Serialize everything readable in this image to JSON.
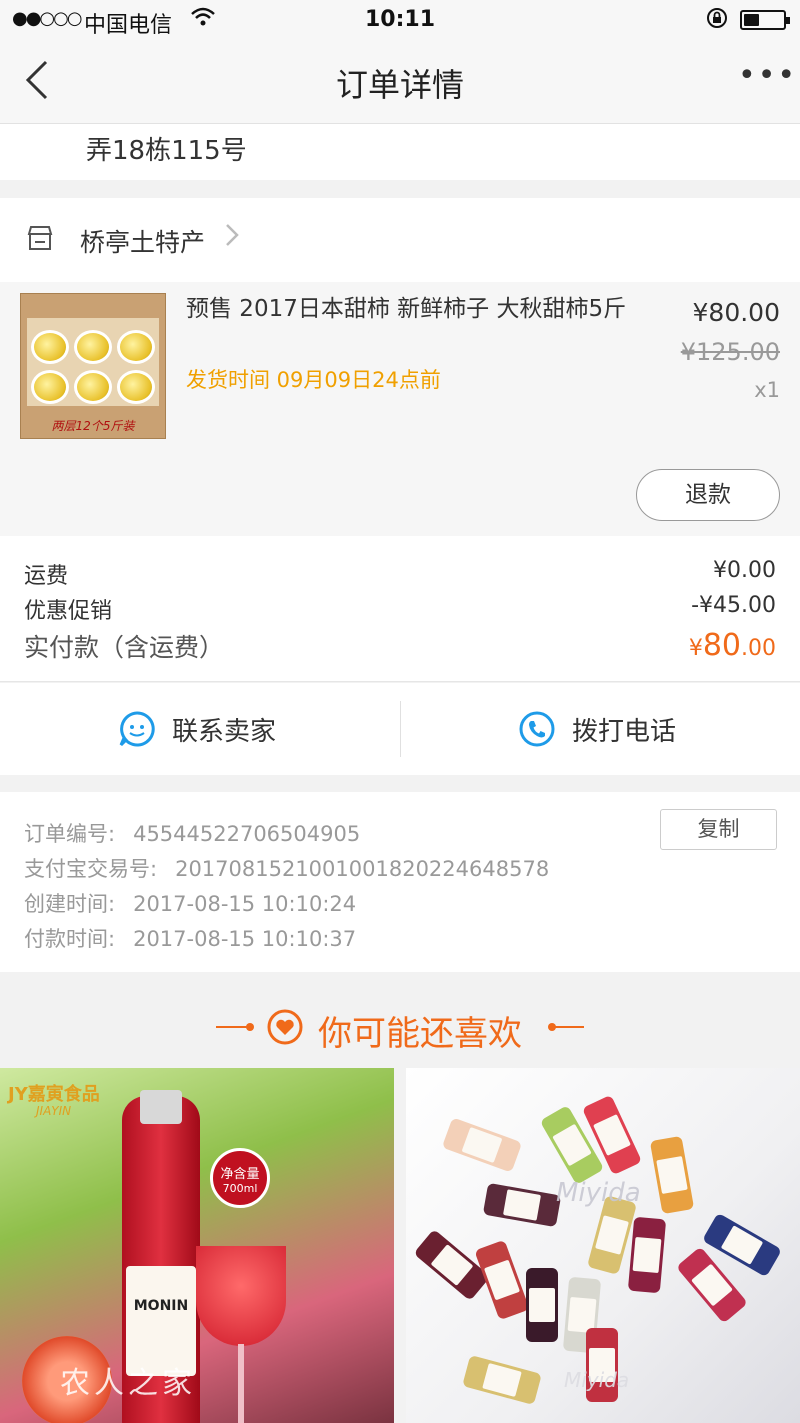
{
  "status_bar": {
    "signal": "●●○○○",
    "carrier": "中国电信",
    "time": "10:11",
    "battery_level": 0.4
  },
  "nav": {
    "title": "订单详情",
    "more": "•••"
  },
  "address": {
    "line_tail": "弄18栋115号"
  },
  "shop": {
    "name": "桥亭土特产"
  },
  "product": {
    "title": "预售 2017日本甜柿 新鲜柿子 大秋甜柿5斤",
    "ship_time": "发货时间 09月09日24点前",
    "price": "¥80.00",
    "original_price": "¥125.00",
    "quantity": "x1",
    "thumb_tag": "两层12个5斤装",
    "refund_label": "退款"
  },
  "fees": {
    "shipping_label": "运费",
    "shipping_value": "¥0.00",
    "discount_label": "优惠促销",
    "discount_value": "-¥45.00",
    "total_label": "实付款（含运费）",
    "total_currency": "¥",
    "total_integer": "80",
    "total_decimal": ".00"
  },
  "contact": {
    "seller_label": "联系卖家",
    "call_label": "拨打电话"
  },
  "order_info": {
    "order_no_label": "订单编号:",
    "order_no": "45544522706504905",
    "alipay_label": "支付宝交易号:",
    "alipay_no": "2017081521001001820224648578",
    "created_label": "创建时间:",
    "created_at": "2017-08-15 10:10:24",
    "paid_label": "付款时间:",
    "paid_at": "2017-08-15 10:10:37",
    "copy_label": "复制"
  },
  "recommend": {
    "title": "你可能还喜欢",
    "left": {
      "brand": "JY嘉寅食品",
      "brand_sub": "JIAYIN",
      "bottle_brand": "MONIN",
      "volume_line1": "净含量",
      "volume_line2": "700ml",
      "watermark": "农人之家"
    },
    "right": {
      "watermark": "Miyida"
    }
  },
  "colors": {
    "accent": "#f06a1a",
    "ship_time": "#f0a000",
    "contact_icon": "#1e9be8"
  }
}
